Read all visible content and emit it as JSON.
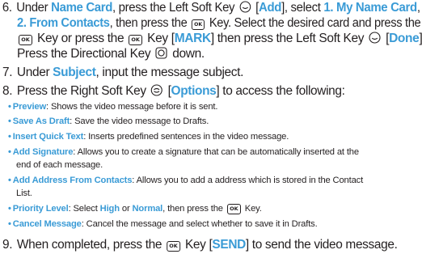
{
  "theme": {
    "accent": "#3a9bd6",
    "text": "#231f20"
  },
  "steps": [
    {
      "num": "6.",
      "line1": {
        "a": "Under ",
        "h1": "Name Card",
        "b": ", press the Left Soft Key ",
        "c": " [",
        "h2": "Add",
        "d": "], select ",
        "h3": "1. My Name Card",
        "e": ","
      },
      "line2": {
        "h1": "2. From Contacts",
        "a": ", then press the ",
        "b": " Key. Select the desired card and press the"
      },
      "line3": {
        "a": " Key or press the ",
        "b": " Key [",
        "h1": "MARK",
        "c": "] then press the Left Soft Key ",
        "d": " [",
        "h2": "Done",
        "e": "]."
      },
      "line4": {
        "a": "Press the Directional Key ",
        "b": " down."
      }
    },
    {
      "num": "7.",
      "a": "Under ",
      "h1": "Subject",
      "b": ", input the message subject."
    },
    {
      "num": "8.",
      "a": "Press the Right Soft Key ",
      "b": " [",
      "h1": "Options",
      "c": "] to access the following:"
    },
    {
      "num": "9.",
      "a": "When completed, press the ",
      "b": " Key [",
      "h1": "SEND",
      "c": "] to send the video message."
    }
  ],
  "ok_key_label": "OK",
  "options": [
    {
      "name": "Preview",
      "desc": ": Shows the video message before it is sent."
    },
    {
      "name": "Save As Draft",
      "desc": ": Save the video message to Drafts."
    },
    {
      "name": "Insert Quick Text",
      "desc": ": Inserts predefined sentences in the video message."
    },
    {
      "name": "Add Signature",
      "desc": ": Allows you to create a signature that can be automatically inserted at the",
      "desc2": "end of each message."
    },
    {
      "name": "Add Address From Contacts",
      "desc": ": Allows you to add a address which is stored in the Contact",
      "desc2": "List."
    },
    {
      "name": "Priority Level",
      "desc_a": ": Select ",
      "high": "High",
      "or": " or ",
      "normal": "Normal",
      "desc_b": ", then press the ",
      "desc_c": " Key."
    },
    {
      "name": "Cancel Message",
      "desc": ": Cancel the message and select whether to save it in Drafts."
    }
  ],
  "bullet": "•"
}
